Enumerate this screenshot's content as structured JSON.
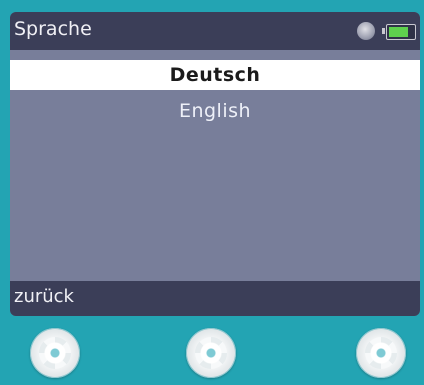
{
  "header": {
    "title": "Sprache",
    "status_icon": "sync-icon",
    "battery_icon": "battery-icon",
    "battery_level": 0.8,
    "battery_color": "#5fd14e"
  },
  "menu": {
    "items": [
      {
        "label": "Deutsch",
        "selected": true
      },
      {
        "label": "English",
        "selected": false
      }
    ]
  },
  "footer": {
    "softkey_left": "zurück"
  },
  "hardware_buttons": [
    "left-softkey",
    "center-softkey",
    "right-softkey"
  ],
  "colors": {
    "device_body": "#23a4b3",
    "screen_bg": "#787e9a",
    "bars": "#3b3e58",
    "selection": "#ffffff"
  }
}
